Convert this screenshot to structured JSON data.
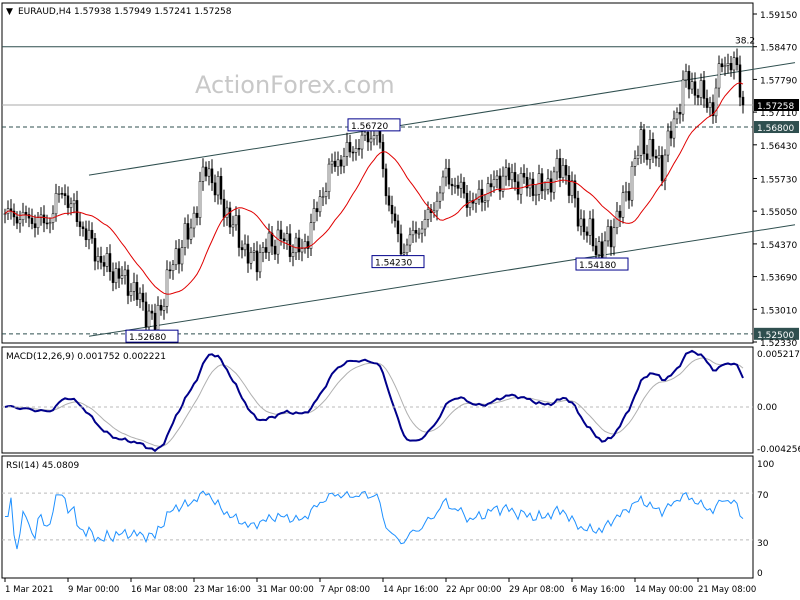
{
  "chart_data": {
    "type": "candlestick",
    "symbol": "EURAUD,H4",
    "ohlc_header": "1.57938 1.57949 1.57241 1.57258",
    "watermark": "ActionForex.com",
    "price_axis": {
      "min": 1.5233,
      "max": 1.5915,
      "ticks": [
        "1.59150",
        "1.58470",
        "1.57790",
        "1.57110",
        "1.56430",
        "1.55730",
        "1.55050",
        "1.54370",
        "1.53690",
        "1.53010",
        "1.52330"
      ]
    },
    "current_price": "1.57258",
    "levels": [
      {
        "value": 1.5847,
        "label": "38.2",
        "style": "solid"
      },
      {
        "value": 1.568,
        "label": "1.56800",
        "style": "dashed"
      },
      {
        "value": 1.525,
        "label": "1.52500",
        "style": "dashed"
      }
    ],
    "annotations": [
      {
        "label": "1.56720",
        "bar": 123,
        "value": 1.5672
      },
      {
        "label": "1.54230",
        "bar": 131,
        "value": 1.5423
      },
      {
        "label": "1.54180",
        "bar": 199,
        "value": 1.5418
      },
      {
        "label": "1.52680",
        "bar": 49,
        "value": 1.5268
      }
    ],
    "channel": {
      "upper": [
        [
          28,
          1.558
        ],
        [
          250,
          1.5801
        ]
      ],
      "lower": [
        [
          28,
          1.5245
        ],
        [
          250,
          1.5464
        ]
      ]
    },
    "close_path": [
      [
        0,
        1.55
      ],
      [
        14,
        1.548
      ],
      [
        19,
        1.555
      ],
      [
        32,
        1.54
      ],
      [
        42,
        1.535
      ],
      [
        50,
        1.5268
      ],
      [
        56,
        1.54
      ],
      [
        62,
        1.547
      ],
      [
        67,
        1.56
      ],
      [
        74,
        1.55
      ],
      [
        82,
        1.54
      ],
      [
        91,
        1.545
      ],
      [
        99,
        1.542
      ],
      [
        109,
        1.56
      ],
      [
        119,
        1.565
      ],
      [
        124,
        1.5672
      ],
      [
        127,
        1.555
      ],
      [
        132,
        1.5423
      ],
      [
        142,
        1.55
      ],
      [
        147,
        1.558
      ],
      [
        156,
        1.552
      ],
      [
        166,
        1.558
      ],
      [
        179,
        1.555
      ],
      [
        186,
        1.56
      ],
      [
        192,
        1.548
      ],
      [
        199,
        1.5418
      ],
      [
        206,
        1.552
      ],
      [
        212,
        1.565
      ],
      [
        219,
        1.56
      ],
      [
        227,
        1.578
      ],
      [
        236,
        1.572
      ],
      [
        239,
        1.582
      ],
      [
        244,
        1.58
      ],
      [
        246,
        1.5726
      ]
    ],
    "ma_period": 20,
    "macd": {
      "label": "MACD(12,26,9) 0.001752 0.002221",
      "ticks": [
        "0.005217",
        "0.00",
        "-0.004256"
      ],
      "max": 0.005217,
      "min": -0.004256
    },
    "rsi": {
      "label": "RSI(14) 45.0809",
      "ticks": [
        "100",
        "70",
        "30",
        "0"
      ]
    },
    "time_labels": [
      {
        "bar": 0,
        "label": "1 Mar 2021"
      },
      {
        "bar": 21,
        "label": "9 Mar 00:00"
      },
      {
        "bar": 42,
        "label": "16 Mar 08:00"
      },
      {
        "bar": 63,
        "label": "23 Mar 16:00"
      },
      {
        "bar": 84,
        "label": "31 Mar 00:00"
      },
      {
        "bar": 105,
        "label": "7 Apr 08:00"
      },
      {
        "bar": 126,
        "label": "14 Apr 16:00"
      },
      {
        "bar": 147,
        "label": "22 Apr 00:00"
      },
      {
        "bar": 168,
        "label": "29 Apr 08:00"
      },
      {
        "bar": 189,
        "label": "6 May 16:00"
      },
      {
        "bar": 210,
        "label": "14 May 00:00"
      },
      {
        "bar": 231,
        "label": "21 May 08:00"
      }
    ],
    "colors": {
      "candle": "#000000",
      "ma": "#e00000",
      "channel": "#2f4f4f",
      "macd": "#00008b",
      "signal": "#b0b0b0",
      "rsi": "#1e90ff",
      "label_bg": "#2f4f4f"
    }
  }
}
